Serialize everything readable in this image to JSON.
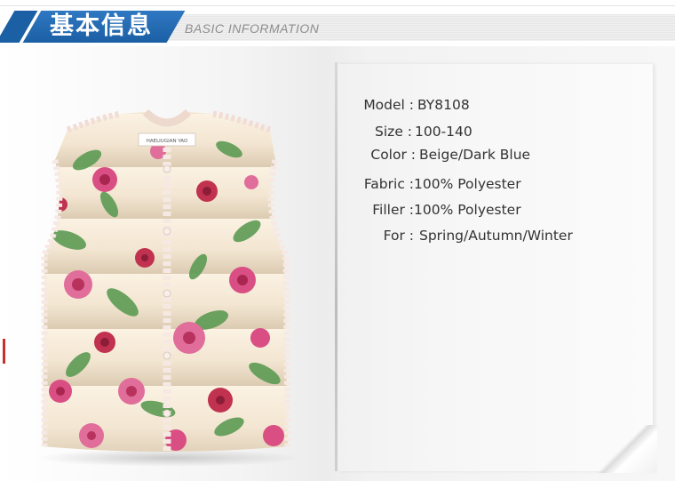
{
  "header": {
    "title": "基本信息",
    "subtitle": "BASIC INFORMATION"
  },
  "product": {
    "vest_label_text": "HAELIUGIAN YAO",
    "colors": {
      "fabric_base": "#f3e6d2",
      "rose_pink": "#d94f84",
      "rose_red": "#c03250",
      "leaf_green": "#5d9b54",
      "header_blue": "#1b5fa4"
    }
  },
  "specs": [
    {
      "label": "Model :",
      "value": "BY8108"
    },
    {
      "label": "Size :",
      "value": "100-140"
    },
    {
      "label": "Color :",
      "value": "Beige/Dark Blue"
    },
    {
      "label": "Fabric :",
      "value": "100%  Polyester"
    },
    {
      "label": "Filler :",
      "value": "100%  Polyester"
    },
    {
      "label": "For :",
      "value": "Spring/Autumn/Winter"
    }
  ]
}
